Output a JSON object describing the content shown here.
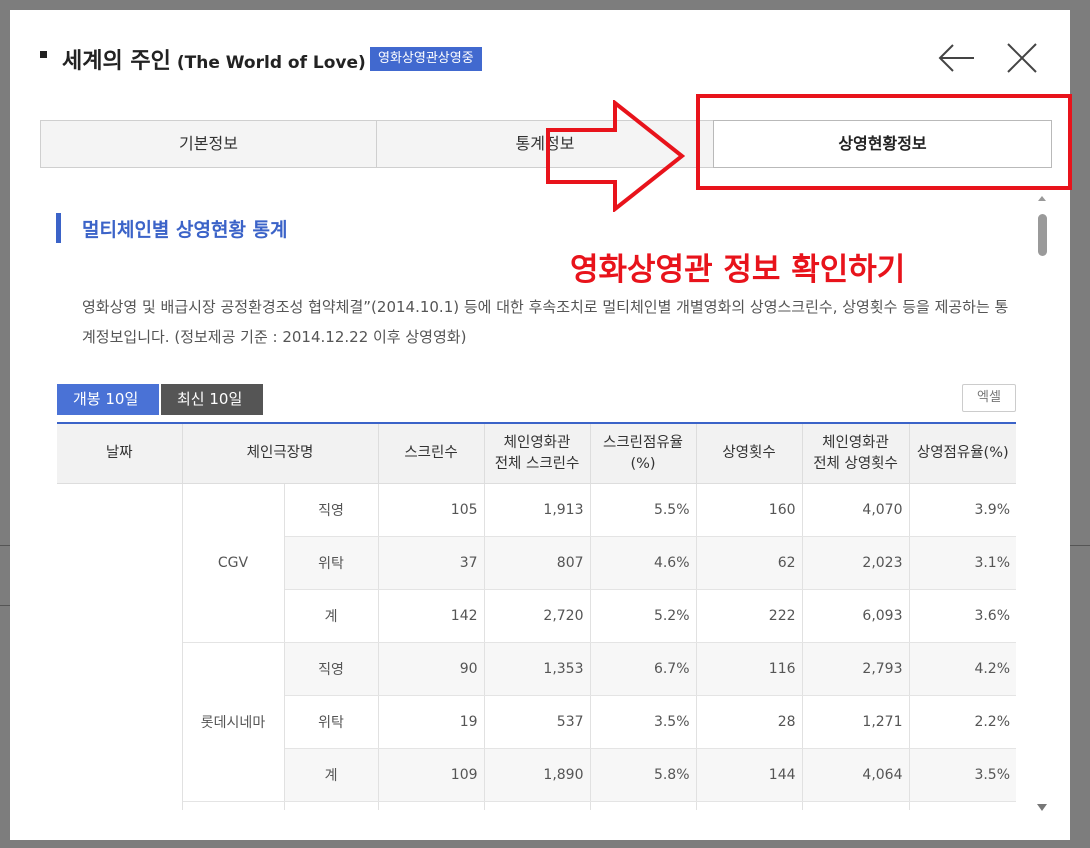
{
  "modal": {
    "title_ko": "세계의 주인",
    "title_en": "(The World of Love)",
    "badge": "영화상영관상영중",
    "back_icon": "arrow-left-icon",
    "close_icon": "close-icon"
  },
  "tabs": [
    {
      "label": "기본정보",
      "active": false
    },
    {
      "label": "통계정보",
      "active": false
    },
    {
      "label": "상영현황정보",
      "active": true
    }
  ],
  "section": {
    "title": "멀티체인별 상영현황 통계",
    "description": "영화상영 및 배급시장 공정환경조성 협약체결”(2014.10.1) 등에 대한 후속조치로 멀티체인별 개별영화의 상영스크린수, 상영횟수 등을 제공하는 통계정보입니다. (정보제공 기준 : 2014.12.22 이후 상영영화)"
  },
  "subtabs": [
    {
      "label": "개봉 10일",
      "color": "#4a72d6"
    },
    {
      "label": "최신 10일",
      "color": "#555555"
    }
  ],
  "excel_button": "엑셀",
  "table": {
    "headers": [
      "날짜",
      "체인극장명",
      "스크린수",
      "체인영화관 전체 스크린수",
      "스크린점유율 (%)",
      "상영횟수",
      "체인영화관 전체 상영횟수",
      "상영점유율(%)"
    ],
    "header_lines": {
      "col4": [
        "체인영화관",
        "전체 스크린수"
      ],
      "col5": [
        "스크린점유율",
        "(%)"
      ],
      "col7": [
        "체인영화관",
        "전체 상영횟수"
      ]
    },
    "groups": [
      {
        "chain": "CGV",
        "rows": [
          {
            "type": "직영",
            "screens": "105",
            "total_screens": "1,913",
            "screen_share": "5.5%",
            "shows": "160",
            "total_shows": "4,070",
            "show_share": "3.9%"
          },
          {
            "type": "위탁",
            "screens": "37",
            "total_screens": "807",
            "screen_share": "4.6%",
            "shows": "62",
            "total_shows": "2,023",
            "show_share": "3.1%"
          },
          {
            "type": "계",
            "screens": "142",
            "total_screens": "2,720",
            "screen_share": "5.2%",
            "shows": "222",
            "total_shows": "6,093",
            "show_share": "3.6%"
          }
        ]
      },
      {
        "chain": "롯데시네마",
        "rows": [
          {
            "type": "직영",
            "screens": "90",
            "total_screens": "1,353",
            "screen_share": "6.7%",
            "shows": "116",
            "total_shows": "2,793",
            "show_share": "4.2%"
          },
          {
            "type": "위탁",
            "screens": "19",
            "total_screens": "537",
            "screen_share": "3.5%",
            "shows": "28",
            "total_shows": "1,271",
            "show_share": "2.2%"
          },
          {
            "type": "계",
            "screens": "109",
            "total_screens": "1,890",
            "screen_share": "5.8%",
            "shows": "144",
            "total_shows": "4,064",
            "show_share": "3.5%"
          }
        ]
      }
    ]
  },
  "annotation": {
    "text": "영화상영관 정보 확인하기",
    "color": "#e8131b"
  }
}
